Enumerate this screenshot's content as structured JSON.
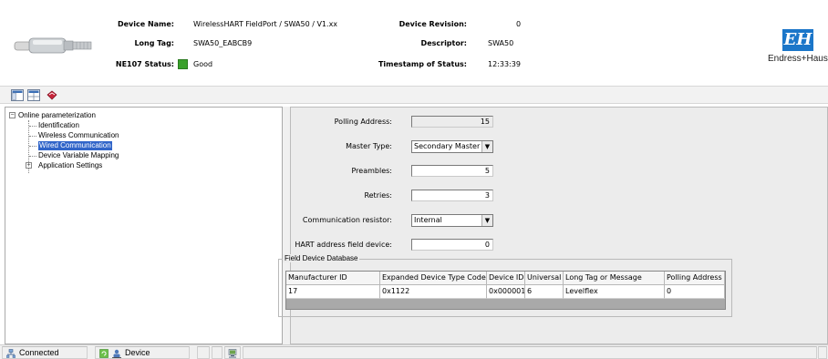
{
  "header": {
    "device_name_label": "Device Name:",
    "device_name_value": "WirelessHART FieldPort / SWA50 / V1.xx",
    "long_tag_label": "Long Tag:",
    "long_tag_value": "SWA50_EABCB9",
    "ne107_label": "NE107 Status:",
    "ne107_value": "Good",
    "ne107_color": "#3aa02b",
    "device_revision_label": "Device Revision:",
    "device_revision_value": "0",
    "descriptor_label": "Descriptor:",
    "descriptor_value": "SWA50",
    "timestamp_label": "Timestamp of Status:",
    "timestamp_value": "12:33:39",
    "logo_mark": "EH",
    "logo_text": "Endress+Hauser"
  },
  "toolbar": {
    "icons": [
      "layout-window-icon",
      "layout-table-icon",
      "book-icon"
    ]
  },
  "tree": {
    "root": "Online parameterization",
    "items": [
      "Identification",
      "Wireless Communication",
      "Wired Communication",
      "Device Variable Mapping",
      "Application Settings"
    ],
    "selected": "Wired Communication"
  },
  "form": {
    "polling_address_label": "Polling Address:",
    "polling_address_value": "15",
    "master_type_label": "Master Type:",
    "master_type_value": "Secondary Master",
    "preambles_label": "Preambles:",
    "preambles_value": "5",
    "retries_label": "Retries:",
    "retries_value": "3",
    "comm_resistor_label": "Communication resistor:",
    "comm_resistor_value": "Internal",
    "hart_address_label": "HART address field device:",
    "hart_address_value": "0"
  },
  "field_device_db": {
    "title": "Field Device Database",
    "columns": [
      "Manufacturer ID",
      "Expanded Device Type Code",
      "Device ID",
      "Universal",
      "Long Tag or Message",
      "Polling Address"
    ],
    "rows": [
      [
        "17",
        "0x1122",
        "0x000001",
        "6",
        "Levelflex",
        "0"
      ]
    ]
  },
  "statusbar": {
    "connection": "Connected",
    "device": "Device"
  },
  "colors": {
    "selection": "#3165c9",
    "brand_blue": "#1b76c9"
  }
}
